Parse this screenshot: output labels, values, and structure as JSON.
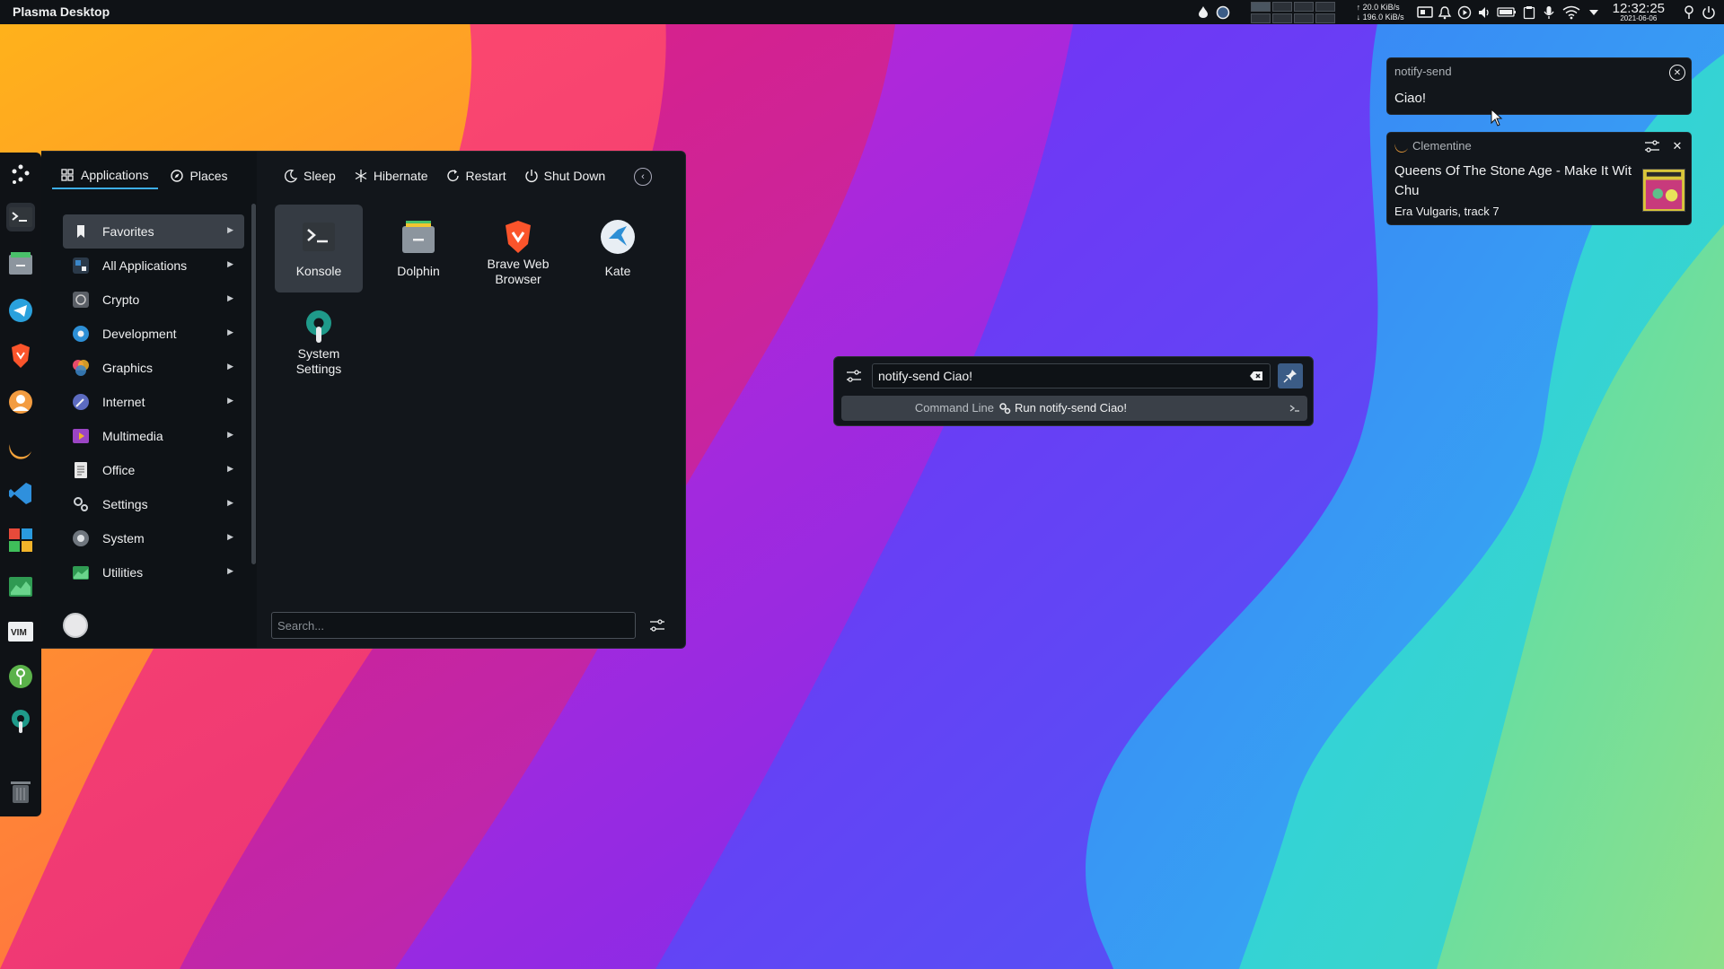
{
  "topbar": {
    "title": "Plasma Desktop",
    "net_up": "20.0 KiB/s",
    "net_down": "196.0 KiB/s",
    "clock_time": "12:32:25",
    "clock_date": "2021-06-06",
    "battery_label": "95%",
    "tray_icons": [
      "drop-icon",
      "circle-icon",
      "chat-icon",
      "bell-icon",
      "play-icon",
      "volume-icon",
      "battery-icon",
      "clipboard-icon",
      "microphone-icon",
      "wifi-icon",
      "expand-icon",
      "pin-icon",
      "power-icon"
    ]
  },
  "dock": {
    "items": [
      "konsole-icon",
      "dolphin-icon",
      "telegram-icon",
      "brave-icon",
      "contacts-icon",
      "clementine-icon",
      "vscode-icon",
      "discover-icon",
      "system-monitor-icon",
      "vim-icon",
      "keepassxc-icon",
      "system-settings-icon",
      "trash-icon"
    ]
  },
  "launcher": {
    "tabs": [
      {
        "label": "Applications",
        "icon": "grid-icon"
      },
      {
        "label": "Places",
        "icon": "compass-icon"
      }
    ],
    "power": [
      {
        "label": "Sleep",
        "icon": "sleep-icon"
      },
      {
        "label": "Hibernate",
        "icon": "hibernate-icon"
      },
      {
        "label": "Restart",
        "icon": "restart-icon"
      },
      {
        "label": "Shut Down",
        "icon": "shutdown-icon"
      }
    ],
    "categories": [
      {
        "label": "Favorites",
        "icon": "bookmark-icon",
        "color": "#2a2f36"
      },
      {
        "label": "All Applications",
        "icon": "all-apps-icon",
        "color": "#3a86c8"
      },
      {
        "label": "Crypto",
        "icon": "crypto-icon",
        "color": "#7a7f86"
      },
      {
        "label": "Development",
        "icon": "development-icon",
        "color": "#2d8fd5"
      },
      {
        "label": "Graphics",
        "icon": "graphics-icon",
        "color": "#e94b6a"
      },
      {
        "label": "Internet",
        "icon": "internet-icon",
        "color": "#5c6bc0"
      },
      {
        "label": "Multimedia",
        "icon": "multimedia-icon",
        "color": "#9b45c4"
      },
      {
        "label": "Office",
        "icon": "office-icon",
        "color": "#e8e8e8"
      },
      {
        "label": "Settings",
        "icon": "settings-icon",
        "color": "#8a8f96"
      },
      {
        "label": "System",
        "icon": "system-icon",
        "color": "#6f767e"
      },
      {
        "label": "Utilities",
        "icon": "utilities-icon",
        "color": "#38b36a"
      }
    ],
    "favorites": [
      {
        "label": "Konsole",
        "icon": "konsole-icon"
      },
      {
        "label": "Dolphin",
        "icon": "dolphin-icon"
      },
      {
        "label": "Brave Web Browser",
        "icon": "brave-icon"
      },
      {
        "label": "Kate",
        "icon": "kate-icon"
      },
      {
        "label": "System Settings",
        "icon": "system-settings-icon"
      }
    ],
    "search_placeholder": "Search..."
  },
  "krunner": {
    "query": "notify-send Ciao!",
    "result_category": "Command Line",
    "result_text": "Run notify-send Ciao!"
  },
  "notifications": [
    {
      "app": "notify-send",
      "body": "Ciao!"
    },
    {
      "app": "Clementine",
      "title": "Queens Of The Stone Age - Make It Wit Chu",
      "subtitle": "Era Vulgaris, track 7"
    }
  ],
  "colors": {
    "panel": "#0f1216",
    "accent": "#3daee9",
    "selection": "#3a4048"
  }
}
